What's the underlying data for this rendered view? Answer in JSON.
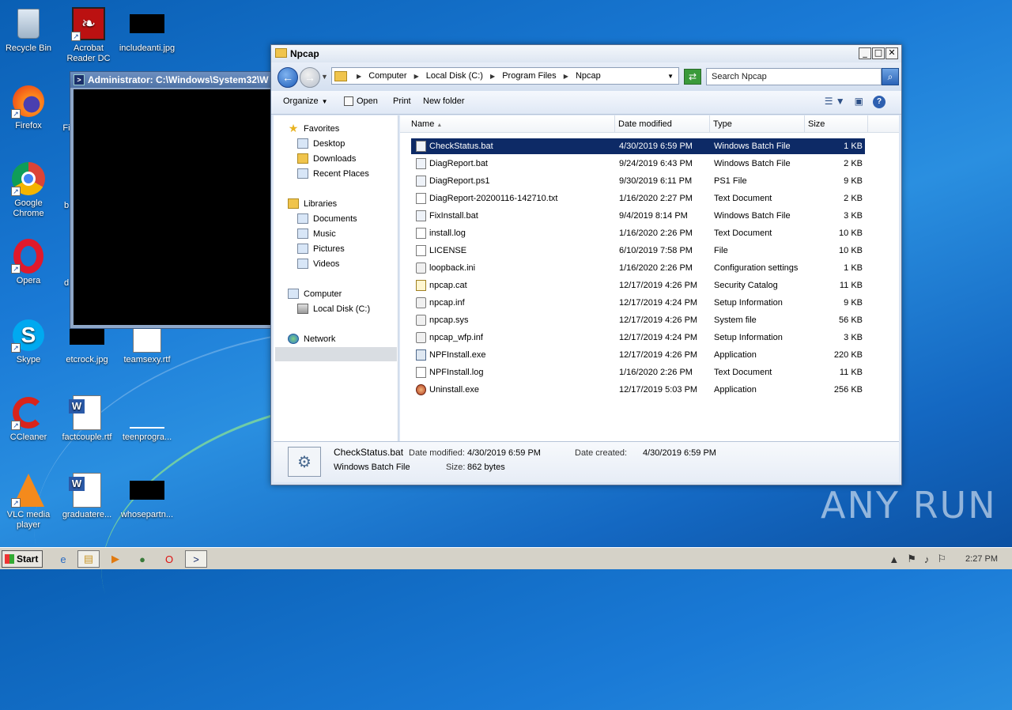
{
  "desktop_icons": [
    {
      "label": "Recycle Bin",
      "icon": "recycle-bin-icon"
    },
    {
      "label": "Acrobat Reader DC",
      "icon": "acrobat-icon"
    },
    {
      "label": "includeanti.jpg",
      "icon": "image-file-icon"
    },
    {
      "label": "Firefox",
      "icon": "firefox-icon"
    },
    {
      "label": "Fi",
      "icon": "truncated-icon"
    },
    {
      "label": "Google Chrome",
      "icon": "chrome-icon"
    },
    {
      "label": "b",
      "icon": "truncated-icon"
    },
    {
      "label": "Opera",
      "icon": "opera-icon"
    },
    {
      "label": "d",
      "icon": "truncated-icon"
    },
    {
      "label": "Skype",
      "icon": "skype-icon"
    },
    {
      "label": "etcrock.jpg",
      "icon": "image-file-icon"
    },
    {
      "label": "teamsexy.rtf",
      "icon": "word-doc-icon"
    },
    {
      "label": "CCleaner",
      "icon": "ccleaner-icon"
    },
    {
      "label": "factcouple.rtf",
      "icon": "word-doc-icon"
    },
    {
      "label": "teenprogra...",
      "icon": "file-icon"
    },
    {
      "label": "VLC media player",
      "icon": "vlc-icon"
    },
    {
      "label": "graduatere...",
      "icon": "word-doc-icon"
    },
    {
      "label": "whosepartn...",
      "icon": "image-file-icon"
    }
  ],
  "console": {
    "title": "Administrator: C:\\Windows\\System32\\W"
  },
  "explorer": {
    "title": "Npcap",
    "breadcrumb": [
      "Computer",
      "Local Disk (C:)",
      "Program Files",
      "Npcap"
    ],
    "search_placeholder": "Search Npcap",
    "toolbar": {
      "organize": "Organize",
      "open": "Open",
      "print": "Print",
      "new_folder": "New folder"
    },
    "nav": {
      "favorites": "Favorites",
      "desktop": "Desktop",
      "downloads": "Downloads",
      "recent": "Recent Places",
      "libraries": "Libraries",
      "documents": "Documents",
      "music": "Music",
      "pictures": "Pictures",
      "videos": "Videos",
      "computer": "Computer",
      "local_disk": "Local Disk (C:)",
      "network": "Network"
    },
    "columns": {
      "name": "Name",
      "date": "Date modified",
      "type": "Type",
      "size": "Size"
    },
    "files": [
      {
        "name": "CheckStatus.bat",
        "date": "4/30/2019 6:59 PM",
        "type": "Windows Batch File",
        "size": "1 KB",
        "icon": "bat"
      },
      {
        "name": "DiagReport.bat",
        "date": "9/24/2019 6:43 PM",
        "type": "Windows Batch File",
        "size": "2 KB",
        "icon": "bat"
      },
      {
        "name": "DiagReport.ps1",
        "date": "9/30/2019 6:11 PM",
        "type": "PS1 File",
        "size": "9 KB",
        "icon": "bat"
      },
      {
        "name": "DiagReport-20200116-142710.txt",
        "date": "1/16/2020 2:27 PM",
        "type": "Text Document",
        "size": "2 KB",
        "icon": "txt"
      },
      {
        "name": "FixInstall.bat",
        "date": "9/4/2019 8:14 PM",
        "type": "Windows Batch File",
        "size": "3 KB",
        "icon": "bat"
      },
      {
        "name": "install.log",
        "date": "1/16/2020 2:26 PM",
        "type": "Text Document",
        "size": "10 KB",
        "icon": "txt"
      },
      {
        "name": "LICENSE",
        "date": "6/10/2019 7:58 PM",
        "type": "File",
        "size": "10 KB",
        "icon": "txt"
      },
      {
        "name": "loopback.ini",
        "date": "1/16/2020 2:26 PM",
        "type": "Configuration settings",
        "size": "1 KB",
        "icon": "cfg"
      },
      {
        "name": "npcap.cat",
        "date": "12/17/2019 4:26 PM",
        "type": "Security Catalog",
        "size": "11 KB",
        "icon": "cat"
      },
      {
        "name": "npcap.inf",
        "date": "12/17/2019 4:24 PM",
        "type": "Setup Information",
        "size": "9 KB",
        "icon": "cfg"
      },
      {
        "name": "npcap.sys",
        "date": "12/17/2019 4:26 PM",
        "type": "System file",
        "size": "56 KB",
        "icon": "cfg"
      },
      {
        "name": "npcap_wfp.inf",
        "date": "12/17/2019 4:24 PM",
        "type": "Setup Information",
        "size": "3 KB",
        "icon": "cfg"
      },
      {
        "name": "NPFInstall.exe",
        "date": "12/17/2019 4:26 PM",
        "type": "Application",
        "size": "220 KB",
        "icon": "exe"
      },
      {
        "name": "NPFInstall.log",
        "date": "1/16/2020 2:26 PM",
        "type": "Text Document",
        "size": "11 KB",
        "icon": "txt"
      },
      {
        "name": "Uninstall.exe",
        "date": "12/17/2019 5:03 PM",
        "type": "Application",
        "size": "256 KB",
        "icon": "uninst"
      }
    ],
    "details": {
      "name": "CheckStatus.bat",
      "type": "Windows Batch File",
      "date_modified_label": "Date modified:",
      "date_modified": "4/30/2019 6:59 PM",
      "size_label": "Size:",
      "size": "862 bytes",
      "date_created_label": "Date created:",
      "date_created": "4/30/2019 6:59 PM"
    }
  },
  "taskbar": {
    "start": "Start",
    "clock": "2:27 PM"
  },
  "watermark": "ANY RUN"
}
